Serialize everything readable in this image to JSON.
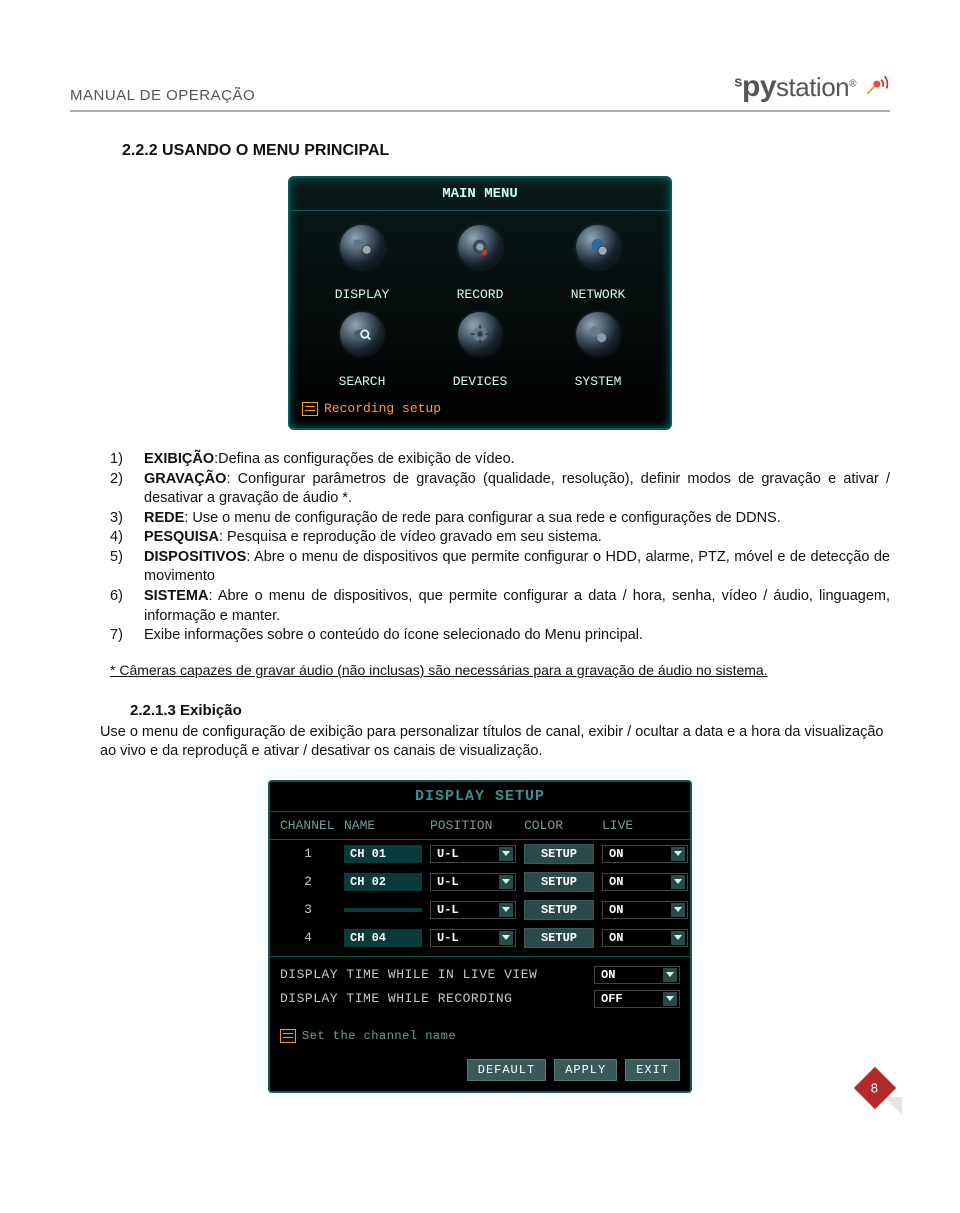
{
  "header": {
    "manual_title": "MANUAL DE OPERAÇÃO",
    "brand": "spystation"
  },
  "section_title": "2.2.2 USANDO O MENU PRINCIPAL",
  "main_menu": {
    "title": "MAIN MENU",
    "items": [
      "DISPLAY",
      "RECORD",
      "NETWORK",
      "SEARCH",
      "DEVICES",
      "SYSTEM"
    ],
    "status": "Recording setup"
  },
  "list": [
    {
      "num": "1)",
      "label": "EXIBIÇÃO",
      "text": ":Defina as configurações de exibição de vídeo."
    },
    {
      "num": "2)",
      "label": "GRAVAÇÃO",
      "text": ": Configurar parâmetros de gravação (qualidade, resolução), definir modos de gravação e ativar / desativar a gravação de áudio *."
    },
    {
      "num": "3)",
      "label": "REDE",
      "text": ": Use o menu de configuração de rede para configurar a sua rede e configurações de DDNS."
    },
    {
      "num": "4)",
      "label": "PESQUISA",
      "text": ": Pesquisa e reprodução de vídeo gravado em seu sistema."
    },
    {
      "num": "5)",
      "label": "DISPOSITIVOS",
      "text": ": Abre o menu de dispositivos que permite configurar o HDD, alarme, PTZ, móvel e de detecção de movimento"
    },
    {
      "num": "6)",
      "label": "SISTEMA",
      "text": ": Abre o menu de dispositivos, que permite configurar a data / hora, senha, vídeo / áudio, linguagem, informação e manter."
    },
    {
      "num": "7)",
      "label": "",
      "text": "Exibe informações sobre o conteúdo do ícone selecionado do Menu principal."
    }
  ],
  "footnote": "* Câmeras capazes de gravar áudio (não inclusas) são necessárias para a gravação de áudio no sistema.",
  "sub": {
    "title": "2.2.1.3 Exibição",
    "text": "Use o menu de configuração de exibição para personalizar títulos de canal, exibir / ocultar a data e a hora da visualização ao vivo e da reproduçã e ativar / desativar os canais de visualização."
  },
  "display_setup": {
    "title": "DISPLAY SETUP",
    "headers": [
      "CHANNEL",
      "NAME",
      "POSITION",
      "COLOR",
      "LIVE"
    ],
    "rows": [
      {
        "ch": "1",
        "name": "CH 01",
        "pos": "U-L",
        "color": "SETUP",
        "live": "ON"
      },
      {
        "ch": "2",
        "name": "CH 02",
        "pos": "U-L",
        "color": "SETUP",
        "live": "ON"
      },
      {
        "ch": "3",
        "name": "",
        "pos": "U-L",
        "color": "SETUP",
        "live": "ON"
      },
      {
        "ch": "4",
        "name": "CH 04",
        "pos": "U-L",
        "color": "SETUP",
        "live": "ON"
      }
    ],
    "opts": [
      {
        "label": "DISPLAY TIME WHILE IN LIVE VIEW",
        "value": "ON"
      },
      {
        "label": "DISPLAY TIME WHILE RECORDING",
        "value": "OFF"
      }
    ],
    "hint": "Set the channel name",
    "buttons": [
      "DEFAULT",
      "APPLY",
      "EXIT"
    ]
  },
  "page_number": "8"
}
